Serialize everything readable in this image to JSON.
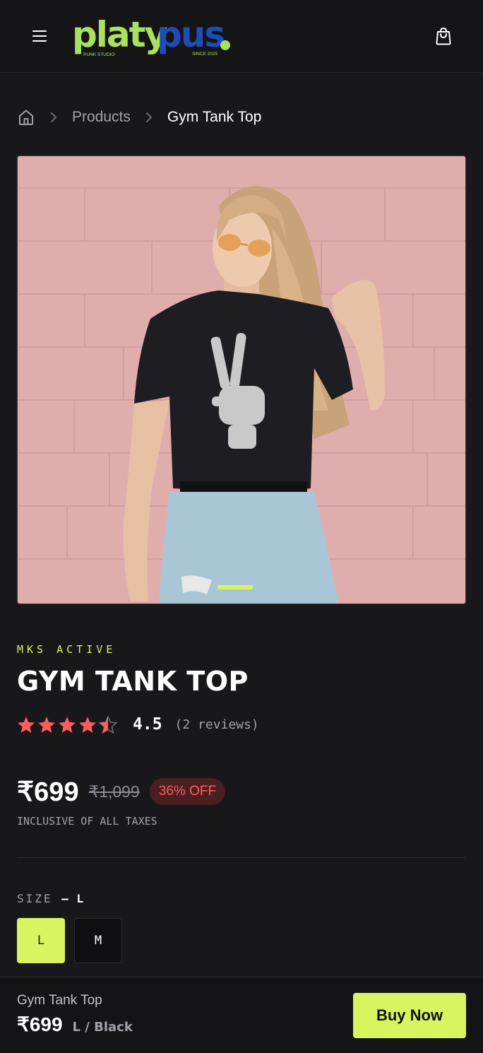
{
  "header": {
    "logo": {
      "brand_part1": "platy",
      "brand_part2": "pus",
      "tagline_left": "PUNK STUDIO",
      "tagline_right": "SINCE 2025"
    },
    "menu_icon": "hamburger-menu-icon",
    "cart_icon": "shopping-bag-icon"
  },
  "breadcrumb": {
    "home_icon": "home-icon",
    "items": [
      {
        "label": "Products"
      },
      {
        "label": "Gym Tank Top"
      }
    ]
  },
  "product": {
    "brand": "MKS ACTIVE",
    "title": "GYM TANK TOP",
    "rating": {
      "value": "4.5",
      "stars_filled": 4.5,
      "stars_total": 5,
      "review_count_text": "(2 reviews)"
    },
    "price": "₹699",
    "mrp": "₹1,099",
    "discount": "36% OFF",
    "tax_note": "INCLUSIVE OF ALL TAXES",
    "image": {
      "slides_total": 1,
      "active_slide": 1
    },
    "size": {
      "label": "SIZE",
      "selected_text": "— L",
      "options": [
        "L",
        "M"
      ],
      "selected": "L"
    }
  },
  "footer": {
    "name": "Gym Tank Top",
    "price": "₹699",
    "variant": "L / Black",
    "buy_label": "Buy Now"
  },
  "colors": {
    "background": "#18181b",
    "accent": "#d9f45f",
    "star": "#ff5c5c",
    "discount_bg": "#4a1f22",
    "discount_text": "#ff5c5c",
    "logo_green": "#a8e05f",
    "logo_blue": "#1e4db8"
  }
}
